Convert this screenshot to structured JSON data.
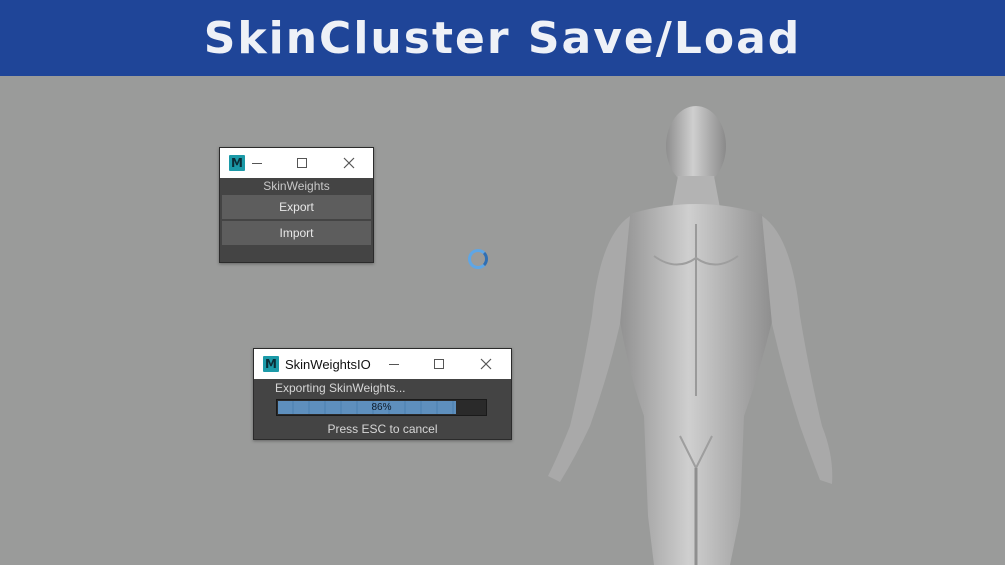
{
  "banner": {
    "title": "SkinCluster Save/Load"
  },
  "skin_weights_window": {
    "app_icon_letter": "M",
    "section_label": "SkinWeights",
    "export_label": "Export",
    "import_label": "Import"
  },
  "io_window": {
    "app_icon_letter": "M",
    "title": "SkinWeightsIO",
    "status": "Exporting SkinWeights...",
    "progress": 0.86,
    "progress_text": "86%",
    "hint": "Press ESC to cancel"
  },
  "colors": {
    "banner": "#1f4598",
    "viewport": "#9a9b9a",
    "panel": "#444444",
    "button": "#5d5d5d",
    "progress_fill": "#5e8fbd",
    "spinner": "#5ea6e6"
  }
}
